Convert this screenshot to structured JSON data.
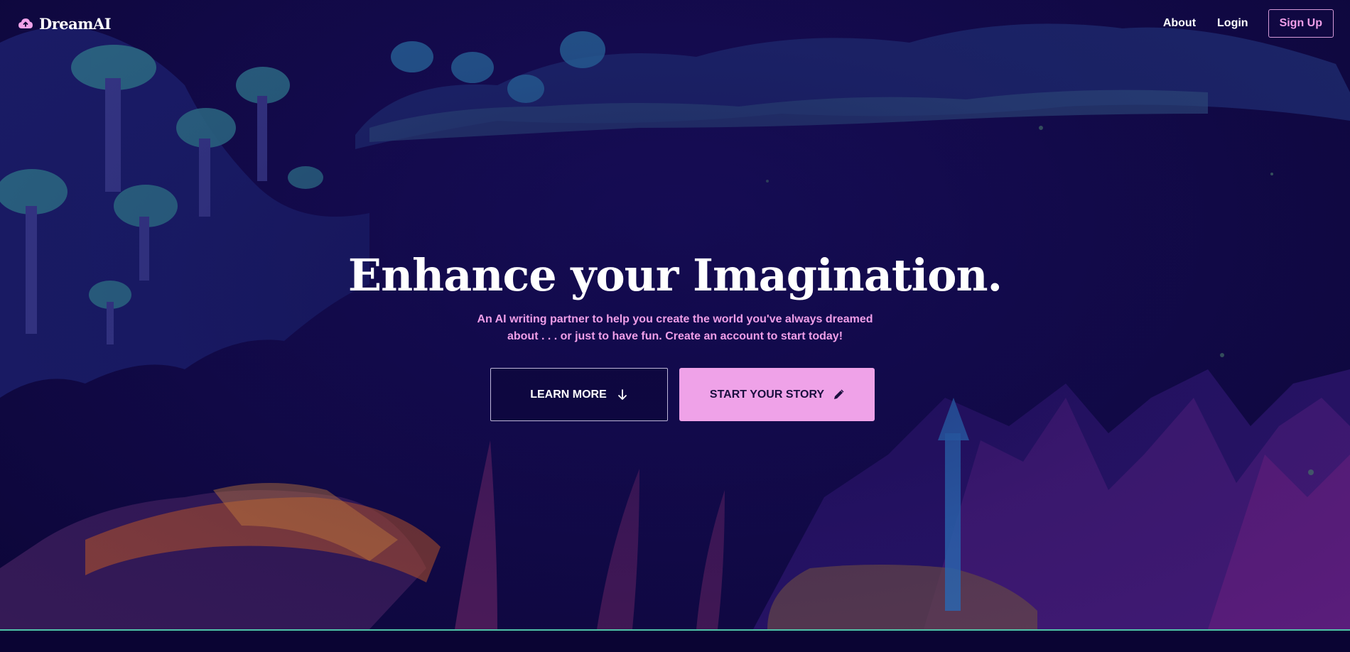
{
  "brand": {
    "name": "DreamAI",
    "icon": "cloud-upload-icon"
  },
  "nav": {
    "about_label": "About",
    "login_label": "Login",
    "signup_label": "Sign Up"
  },
  "hero": {
    "title": "Enhance your Imagination.",
    "subtitle": "An AI writing partner to help you create the world you've always dreamed about . . . or just to have fun. Create an account to start today!",
    "learn_more_label": "LEARN MORE",
    "learn_more_icon": "arrow-down-icon",
    "start_story_label": "START YOUR STORY",
    "start_story_icon": "pencil-icon"
  },
  "colors": {
    "background": "#0b0535",
    "accent_pink": "#efa2e8",
    "divider_teal": "#4fc3a8"
  }
}
